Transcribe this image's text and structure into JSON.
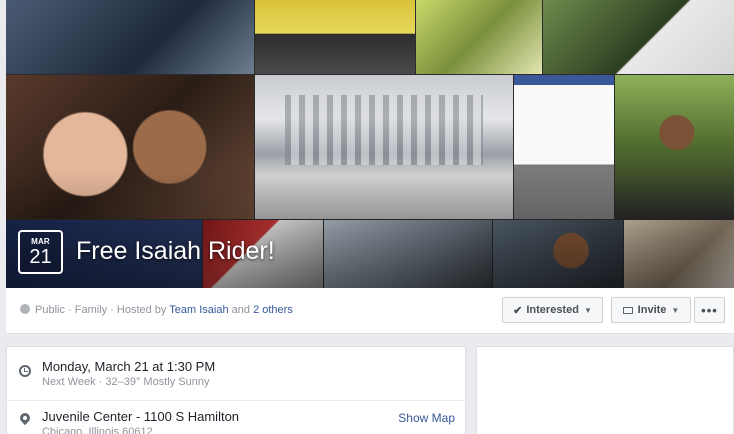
{
  "event": {
    "month": "MAR",
    "day": "21",
    "title": "Free Isaiah Rider!"
  },
  "info_bar": {
    "privacy_text": "Public · Family · Hosted by ",
    "host_link": "Team Isaiah",
    "and_text": " and ",
    "others_link": "2 others",
    "interested_label": "Interested",
    "invite_label": "Invite",
    "more_label": "•••"
  },
  "details": {
    "time_main": "Monday, March 21 at 1:30 PM",
    "time_sub": "Next Week · 32–39° Mostly Sunny",
    "location_main": "Juvenile Center - 1100 S Hamilton",
    "location_sub": "Chicago, Illinois 60612",
    "show_map_label": "Show Map"
  },
  "icons": {
    "privacy": "globe-icon",
    "interested": "check-icon",
    "dropdown": "caret-down-icon",
    "invite": "mail-icon",
    "time": "clock-icon",
    "location": "pin-icon"
  }
}
